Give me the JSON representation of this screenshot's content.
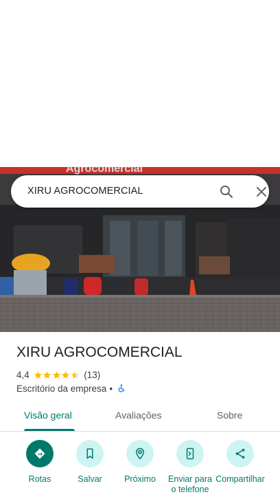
{
  "search": {
    "query": "XIRU AGROCOMERCIAL"
  },
  "photo": {
    "sign_text": "Agrocomercial"
  },
  "place": {
    "name": "XIRU AGROCOMERCIAL",
    "rating": "4,4",
    "stars": 4.5,
    "review_count": "(13)",
    "category": "Escritório da empresa",
    "separator": "•"
  },
  "tabs": [
    {
      "label": "Visão geral",
      "active": true
    },
    {
      "label": "Avaliações",
      "active": false
    },
    {
      "label": "Sobre",
      "active": false
    }
  ],
  "actions": [
    {
      "label": "Rotas",
      "icon": "directions-icon"
    },
    {
      "label": "Salvar",
      "icon": "bookmark-icon"
    },
    {
      "label": "Próximo",
      "icon": "nearby-icon"
    },
    {
      "label": "Enviar para o telefone",
      "icon": "send-to-phone-icon"
    },
    {
      "label": "Compartilhar",
      "icon": "share-icon"
    }
  ],
  "colors": {
    "accent": "#00796b",
    "accent_light": "#cdf4f2",
    "star": "#fbbc04",
    "text": "#202124",
    "secondary_text": "#3c4043"
  }
}
